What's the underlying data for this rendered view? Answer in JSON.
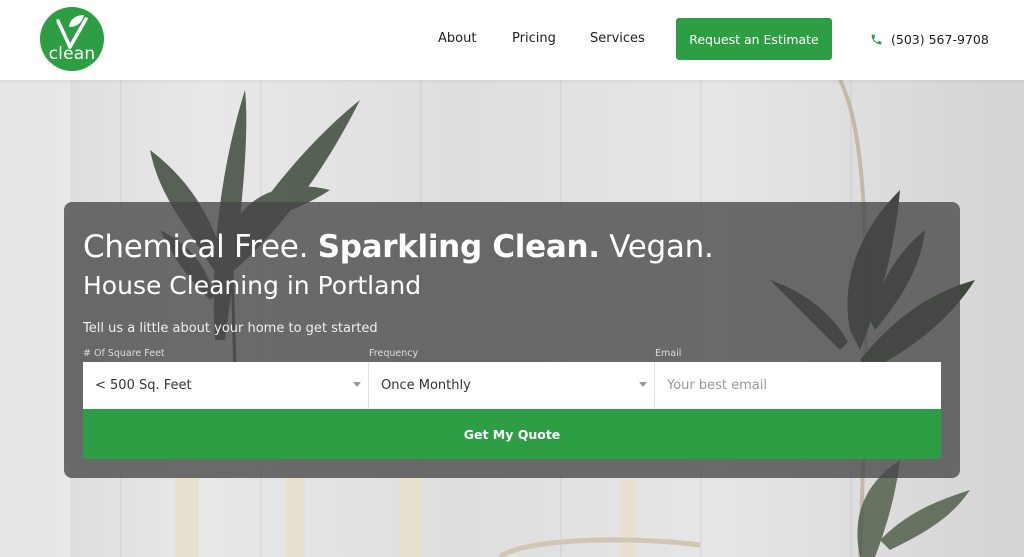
{
  "brand": {
    "logo_text": "clean",
    "accent_color": "#2e9e44"
  },
  "nav": {
    "links": [
      "About",
      "Pricing",
      "Services"
    ],
    "cta_label": "Request an Estimate",
    "phone": "(503) 567-9708",
    "phone_icon": "phone-icon"
  },
  "hero": {
    "headline_part1": "Chemical Free.",
    "headline_bold": "Sparkling Clean.",
    "headline_part3": "Vegan.",
    "subheadline": "House Cleaning in Portland",
    "intro": "Tell us a little about your home to get started"
  },
  "form": {
    "sqft_label": "# Of Square Feet",
    "sqft_value": "< 500 Sq. Feet",
    "frequency_label": "Frequency",
    "frequency_value": "Once Monthly",
    "email_label": "Email",
    "email_placeholder": "Your best email",
    "submit_label": "Get My Quote"
  }
}
